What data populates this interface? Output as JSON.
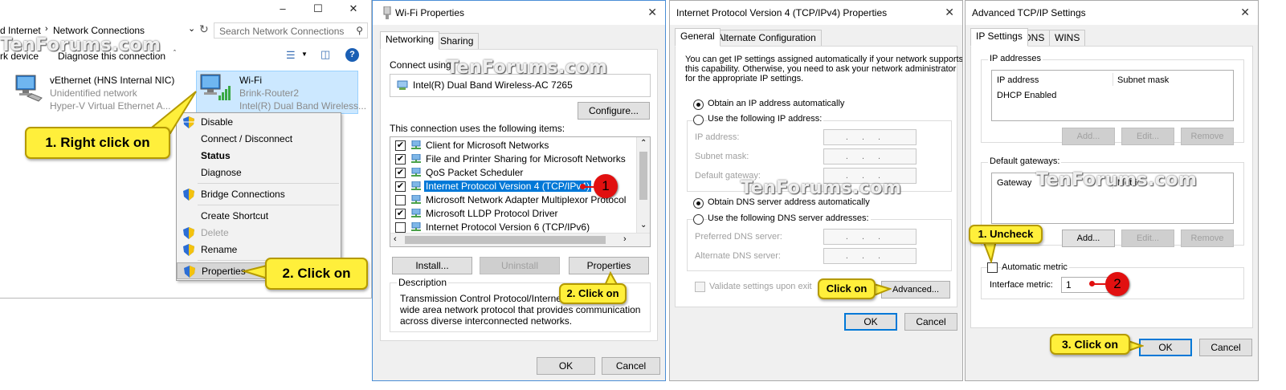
{
  "watermark": "TenForums.com",
  "colors": {
    "dialog_border": "#4a8ed6",
    "selection": "#0078d7",
    "callout": "#ffef3b",
    "marker": "#e11010"
  },
  "explorer": {
    "breadcrumb": [
      "d Internet",
      "Network Connections"
    ],
    "search_placeholder": "Search Network Connections",
    "command_bar": [
      "rk device",
      "Diagnose this connection"
    ],
    "adapters": [
      {
        "name": "vEthernet (HNS Internal NIC)",
        "status": "Unidentified network",
        "device": "Hyper-V Virtual Ethernet A..."
      },
      {
        "name": "Wi-Fi",
        "status": "Brink-Router2",
        "device": "Intel(R) Dual Band Wireless..."
      }
    ],
    "context_menu": [
      {
        "label": "Disable",
        "shield": true
      },
      {
        "label": "Connect / Disconnect",
        "shield": false
      },
      {
        "label": "Status",
        "shield": false,
        "bold": true
      },
      {
        "label": "Diagnose",
        "shield": false
      },
      {
        "label": "Bridge Connections",
        "shield": true
      },
      {
        "label": "Create Shortcut",
        "shield": false
      },
      {
        "label": "Delete",
        "shield": true,
        "disabled": true
      },
      {
        "label": "Rename",
        "shield": true
      },
      {
        "label": "Properties",
        "shield": true
      }
    ],
    "callouts": {
      "right_click": "1. Right click on",
      "click_properties": "2. Click on"
    }
  },
  "wifi_properties": {
    "title": "Wi-Fi Properties",
    "tabs": [
      "Networking",
      "Sharing"
    ],
    "connect_using_label": "Connect using:",
    "adapter": "Intel(R) Dual Band Wireless-AC 7265",
    "configure": "Configure...",
    "items_label": "This connection uses the following items:",
    "items": [
      {
        "label": "Client for Microsoft Networks",
        "checked": true
      },
      {
        "label": "File and Printer Sharing for Microsoft Networks",
        "checked": true
      },
      {
        "label": "QoS Packet Scheduler",
        "checked": true
      },
      {
        "label": "Internet Protocol Version 4 (TCP/IPv4)",
        "checked": true,
        "selected": true
      },
      {
        "label": "Microsoft Network Adapter Multiplexor Protocol",
        "checked": false
      },
      {
        "label": "Microsoft LLDP Protocol Driver",
        "checked": true
      },
      {
        "label": "Internet Protocol Version 6 (TCP/IPv6)",
        "checked": false
      }
    ],
    "buttons": {
      "install": "Install...",
      "uninstall": "Uninstall",
      "properties": "Properties",
      "ok": "OK",
      "cancel": "Cancel"
    },
    "description_label": "Description",
    "description": "Transmission Control Protocol/Internet Protocol. The default wide area network protocol that provides communication across diverse interconnected networks.",
    "description_lines": [
      "Transmission Control Protocol/Internet Pr",
      "wide area network protocol that provides communication",
      "across diverse interconnected networks."
    ],
    "marker": "1",
    "callout": "2. Click on"
  },
  "ipv4": {
    "title": "Internet Protocol Version 4 (TCP/IPv4) Properties",
    "tabs": [
      "General",
      "Alternate Configuration"
    ],
    "intro_lines": [
      "You can get IP settings assigned automatically if your network supports",
      "this capability. Otherwise, you need to ask your network administrator",
      "for the appropriate IP settings."
    ],
    "obtain_ip": "Obtain an IP address automatically",
    "use_ip": "Use the following IP address:",
    "ip_fields": [
      "IP address:",
      "Subnet mask:",
      "Default gateway:"
    ],
    "obtain_dns": "Obtain DNS server address automatically",
    "use_dns": "Use the following DNS server addresses:",
    "dns_fields": [
      "Preferred DNS server:",
      "Alternate DNS server:"
    ],
    "validate": "Validate settings upon exit",
    "advanced": "Advanced...",
    "ok": "OK",
    "cancel": "Cancel",
    "callout": "Click on"
  },
  "advanced": {
    "title": "Advanced TCP/IP Settings",
    "tabs": [
      "IP Settings",
      "DNS",
      "WINS"
    ],
    "ip_addresses_label": "IP addresses",
    "ip_columns": [
      "IP address",
      "Subnet mask"
    ],
    "ip_rows": [
      "DHCP Enabled"
    ],
    "gateways_label": "Default gateways:",
    "gateway_columns": [
      "Gateway",
      "Metric"
    ],
    "buttons": {
      "add": "Add...",
      "edit": "Edit...",
      "remove": "Remove",
      "ok": "OK",
      "cancel": "Cancel"
    },
    "automatic_metric": "Automatic metric",
    "interface_metric_label": "Interface metric:",
    "interface_metric_value": "1",
    "marker": "2",
    "callouts": {
      "uncheck": "1. Uncheck",
      "click_ok": "3. Click on"
    }
  }
}
